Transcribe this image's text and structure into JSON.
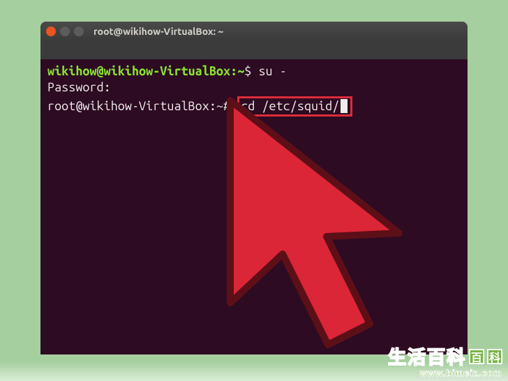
{
  "window": {
    "title": "root@wikihow-VirtualBox: ~"
  },
  "terminal": {
    "line1": {
      "user_host": "wikihow@wikihow-VirtualBox",
      "path": "~",
      "symbol": "$",
      "command": "su -"
    },
    "line2": {
      "text": "Password:"
    },
    "line3": {
      "user_host": "root@wikihow-VirtualBox",
      "path": "~",
      "symbol": "#",
      "command": "cd /etc/squid/"
    }
  },
  "watermark": {
    "text": "生活百科",
    "url": "www.bimeiz.com"
  },
  "colors": {
    "page_bg": "#a6cf9f",
    "terminal_bg": "#2d0b22",
    "prompt_user": "#8ae234",
    "highlight_red": "#dd2c3b",
    "cursor_fill": "#db2638"
  }
}
